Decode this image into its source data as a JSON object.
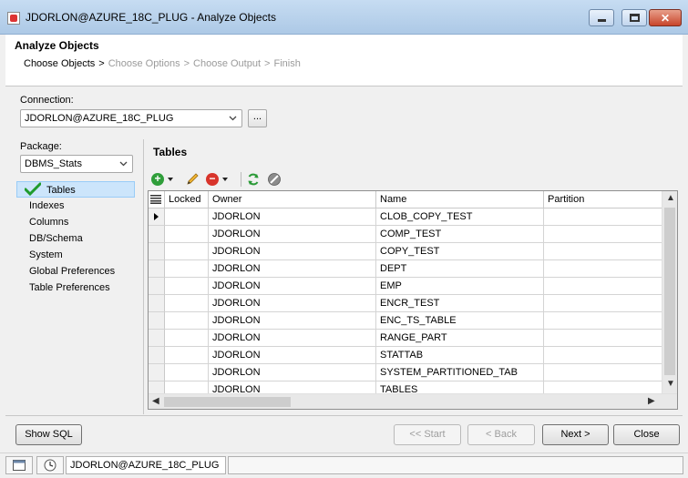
{
  "window": {
    "title": "JDORLON@AZURE_18C_PLUG - Analyze Objects",
    "close_glyph": "✕"
  },
  "dialog": {
    "heading": "Analyze Objects",
    "steps": [
      "Choose Objects",
      "Choose Options",
      "Choose Output",
      "Finish"
    ],
    "step_separator": ">"
  },
  "connection": {
    "label": "Connection:",
    "value": "JDORLON@AZURE_18C_PLUG",
    "browse_label": "..."
  },
  "package": {
    "label": "Package:",
    "value": "DBMS_Stats"
  },
  "nav": {
    "items": [
      {
        "label": "Tables"
      },
      {
        "label": "Indexes"
      },
      {
        "label": "Columns"
      },
      {
        "label": "DB/Schema"
      },
      {
        "label": "System"
      },
      {
        "label": "Global Preferences"
      },
      {
        "label": "Table Preferences"
      }
    ],
    "selected": "Tables"
  },
  "tables": {
    "heading": "Tables",
    "columns": [
      "Locked",
      "Owner",
      "Name",
      "Partition"
    ],
    "rows": [
      {
        "locked": "",
        "owner": "JDORLON",
        "name": "CLOB_COPY_TEST",
        "partition": ""
      },
      {
        "locked": "",
        "owner": "JDORLON",
        "name": "COMP_TEST",
        "partition": ""
      },
      {
        "locked": "",
        "owner": "JDORLON",
        "name": "COPY_TEST",
        "partition": ""
      },
      {
        "locked": "",
        "owner": "JDORLON",
        "name": "DEPT",
        "partition": ""
      },
      {
        "locked": "",
        "owner": "JDORLON",
        "name": "EMP",
        "partition": ""
      },
      {
        "locked": "",
        "owner": "JDORLON",
        "name": "ENCR_TEST",
        "partition": ""
      },
      {
        "locked": "",
        "owner": "JDORLON",
        "name": "ENC_TS_TABLE",
        "partition": ""
      },
      {
        "locked": "",
        "owner": "JDORLON",
        "name": "RANGE_PART",
        "partition": ""
      },
      {
        "locked": "",
        "owner": "JDORLON",
        "name": "STATTAB",
        "partition": ""
      },
      {
        "locked": "",
        "owner": "JDORLON",
        "name": "SYSTEM_PARTITIONED_TAB",
        "partition": ""
      },
      {
        "locked": "",
        "owner": "JDORLON",
        "name": "TABLES",
        "partition": ""
      }
    ]
  },
  "toolbar": {
    "icons": [
      "add-icon",
      "edit-pencil-icon",
      "remove-icon",
      "refresh-icon",
      "clear-icon"
    ]
  },
  "buttons": {
    "show_sql": "Show SQL",
    "start": "<< Start",
    "back": "< Back",
    "next": "Next >",
    "close": "Close"
  },
  "status": {
    "connection": "JDORLON@AZURE_18C_PLUG"
  }
}
